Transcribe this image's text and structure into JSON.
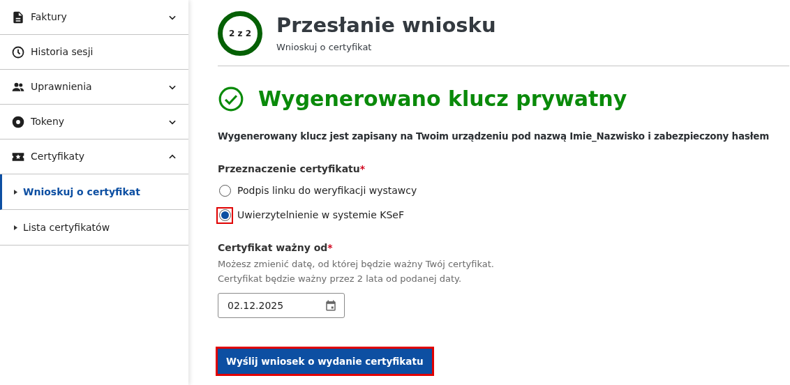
{
  "sidebar": {
    "items": [
      {
        "label": "Faktury",
        "kind": "expandable",
        "expanded": false
      },
      {
        "label": "Historia sesji",
        "kind": "link"
      },
      {
        "label": "Uprawnienia",
        "kind": "expandable",
        "expanded": false
      },
      {
        "label": "Tokeny",
        "kind": "expandable",
        "expanded": false
      },
      {
        "label": "Certyfikaty",
        "kind": "expandable",
        "expanded": true,
        "children": [
          {
            "label": "Wnioskuj o certyfikat",
            "selected": true
          },
          {
            "label": "Lista certyfikatów",
            "selected": false
          }
        ]
      }
    ]
  },
  "step": {
    "indicator": "2 z 2",
    "title": "Przesłanie wniosku",
    "subtitle": "Wnioskuj o certyfikat"
  },
  "success": {
    "title": "Wygenerowano klucz prywatny",
    "message": "Wygenerowany klucz jest zapisany na Twoim urządzeniu pod nazwą Imie_Nazwisko i zabezpieczony hasłem"
  },
  "purpose": {
    "label": "Przeznaczenie certyfikatu",
    "required_mark": "*",
    "options": [
      {
        "label": "Podpis linku do weryfikacji wystawcy",
        "selected": false,
        "highlighted": false
      },
      {
        "label": "Uwierzytelnienie w systemie KSeF",
        "selected": true,
        "highlighted": true
      }
    ]
  },
  "valid_from": {
    "label": "Certyfikat ważny od",
    "required_mark": "*",
    "hint": "Możesz zmienić datę, od której będzie ważny Twój certyfikat. Certyfikat będzie ważny przez 2 lata od podanej daty.",
    "value": "02.12.2025"
  },
  "submit": {
    "label": "Wyślij wniosek o wydanie certyfikatu",
    "highlighted": true
  }
}
